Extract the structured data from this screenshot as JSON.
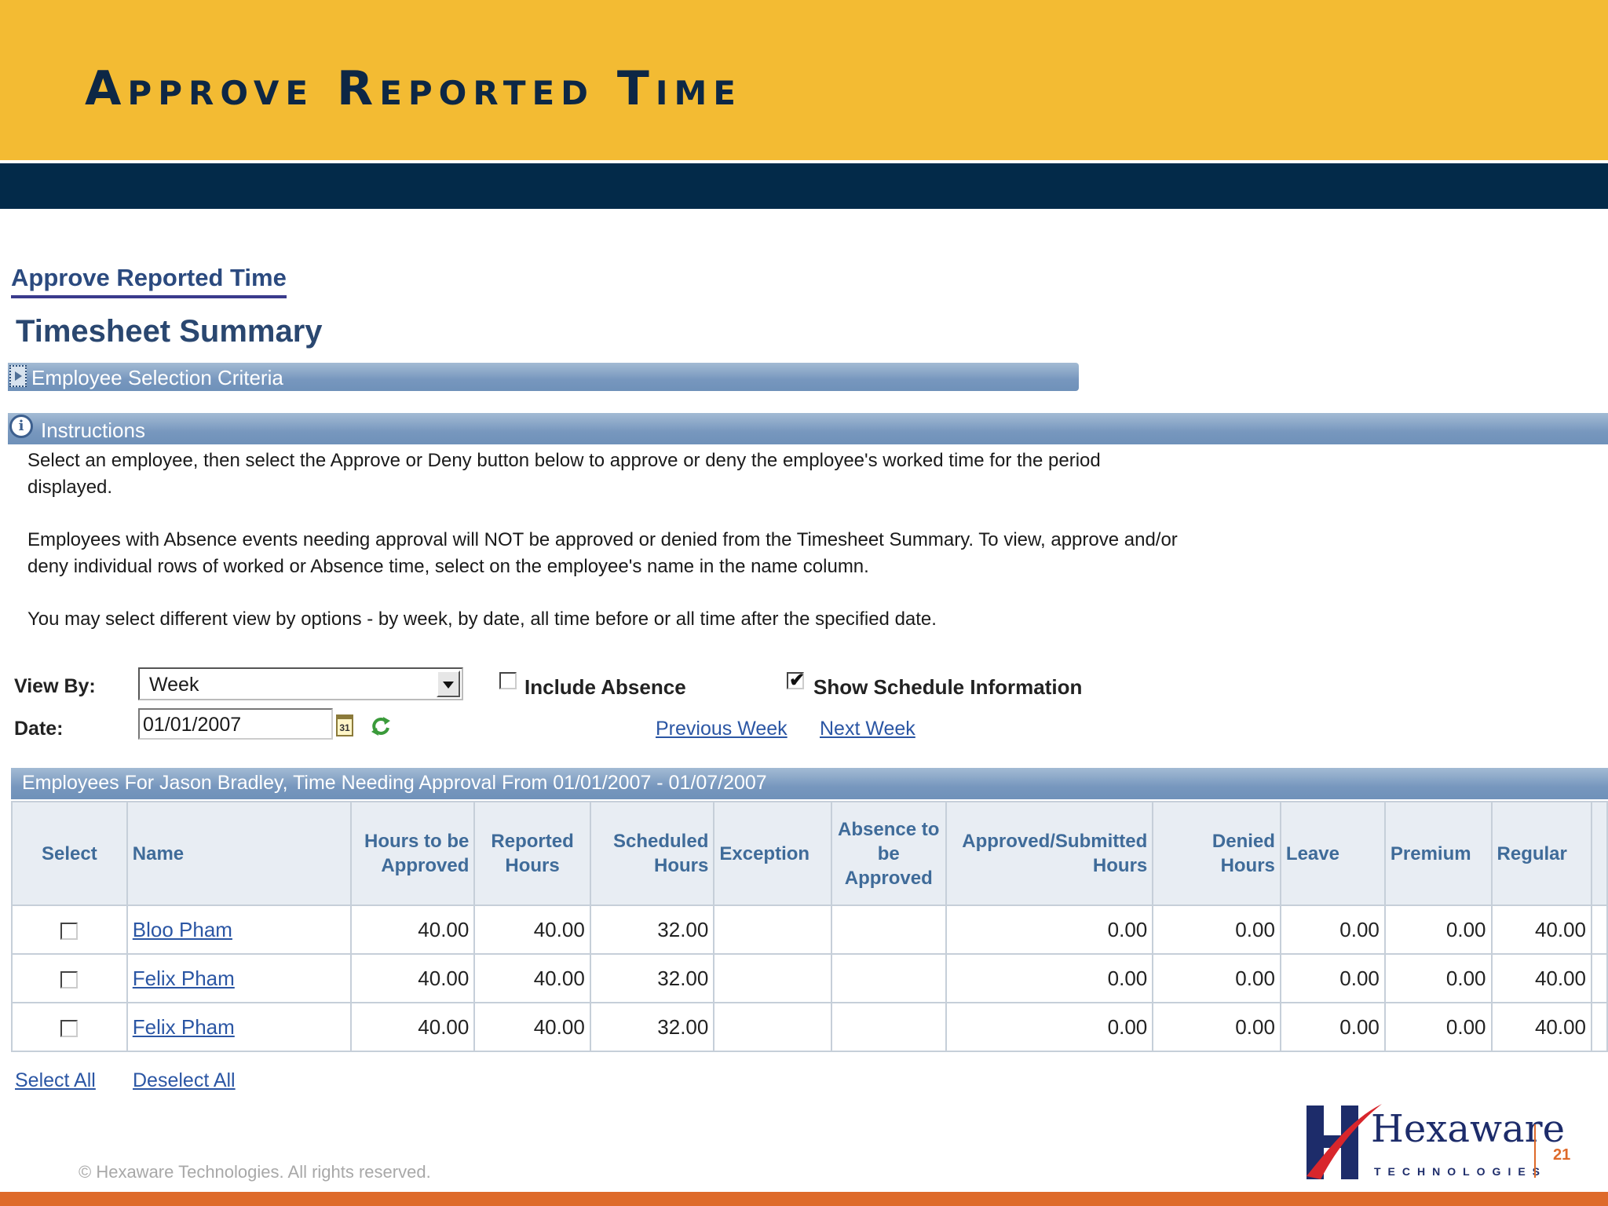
{
  "slide": {
    "title": "Approve Reported Time",
    "copyright": "© Hexaware Technologies. All rights reserved.",
    "page_number": "21",
    "logo": {
      "name": "Hexaware",
      "tagline": "TECHNOLOGIES"
    }
  },
  "page": {
    "link_title": "Approve Reported Time",
    "heading": "Timesheet Summary",
    "criteria_section": "Employee Selection Criteria",
    "instructions_title": "Instructions",
    "instructions": [
      "Select an employee, then select the Approve or Deny button below to approve or deny the employee's worked time for the period displayed.",
      "Employees with Absence events needing approval will NOT be approved or denied from the Timesheet Summary.  To view, approve and/or deny individual rows of worked or Absence time, select on the employee's name in the name column.",
      "You may select different view by options - by week, by date, all time before or all time after the specified date."
    ]
  },
  "controls": {
    "view_by_label": "View By:",
    "view_by_value": "Week",
    "include_absence_label": "Include Absence",
    "include_absence_checked": false,
    "show_schedule_label": "Show Schedule Information",
    "show_schedule_checked": true,
    "date_label": "Date:",
    "date_value": "01/01/2007",
    "calendar_icon_text": "31",
    "previous_week": "Previous Week",
    "next_week": "Next Week"
  },
  "grid": {
    "title": "Employees For Jason Bradley, Time Needing Approval From 01/01/2007 - 01/07/2007",
    "columns": [
      "Select",
      "Name",
      "Hours to be Approved",
      "Reported Hours",
      "Scheduled Hours",
      "Exception",
      "Absence to be Approved",
      "Approved/Submitted Hours",
      "Denied Hours",
      "Leave",
      "Premium",
      "Regular"
    ],
    "rows": [
      {
        "name": "Bloo Pham",
        "hours_to_approve": "40.00",
        "reported": "40.00",
        "scheduled": "32.00",
        "exception": "",
        "absence": "",
        "approved": "0.00",
        "denied": "0.00",
        "leave": "0.00",
        "premium": "0.00",
        "regular": "40.00"
      },
      {
        "name": "Felix Pham",
        "hours_to_approve": "40.00",
        "reported": "40.00",
        "scheduled": "32.00",
        "exception": "",
        "absence": "",
        "approved": "0.00",
        "denied": "0.00",
        "leave": "0.00",
        "premium": "0.00",
        "regular": "40.00"
      },
      {
        "name": "Felix Pham",
        "hours_to_approve": "40.00",
        "reported": "40.00",
        "scheduled": "32.00",
        "exception": "",
        "absence": "",
        "approved": "0.00",
        "denied": "0.00",
        "leave": "0.00",
        "premium": "0.00",
        "regular": "40.00"
      }
    ],
    "select_all": "Select All",
    "deselect_all": "Deselect All"
  },
  "colors": {
    "banner": "#f3bb33",
    "navy": "#032a49",
    "accent_orange": "#de6a2a",
    "section_bar": "#7797be",
    "link": "#2b56a4"
  },
  "icons": [
    "expand-arrow-icon",
    "info-icon",
    "dropdown-arrow-icon",
    "calendar-icon",
    "refresh-icon",
    "checkbox-icon"
  ]
}
